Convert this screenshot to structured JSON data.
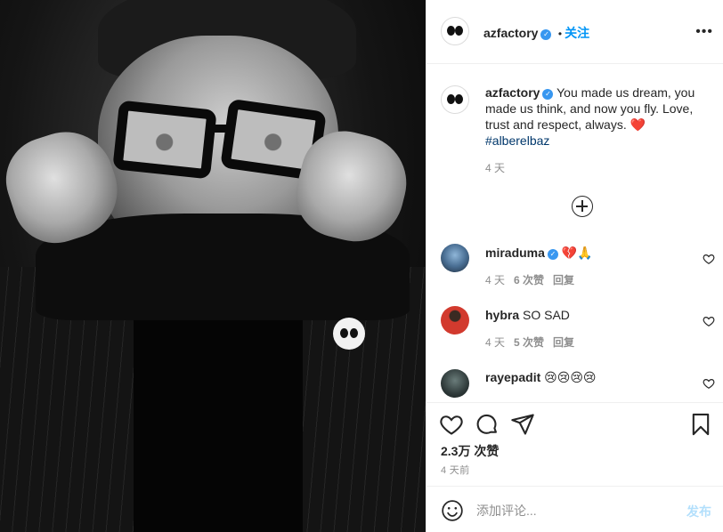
{
  "post": {
    "account": "azfactory",
    "follow_label": "关注",
    "separator": "•",
    "more_glyph": "•••"
  },
  "caption": {
    "username": "azfactory",
    "text": "You made us dream, you made us think, and now you fly. Love, trust and respect, always. ❤️",
    "hashtag": "#alberelbaz",
    "time": "4 天"
  },
  "comments": [
    {
      "username": "miraduma",
      "verified": true,
      "text": "💔🙏",
      "time": "4 天",
      "likes": "6 次赞",
      "reply": "回复"
    },
    {
      "username": "hybra",
      "verified": false,
      "text": "SO SAD",
      "time": "4 天",
      "likes": "5 次赞",
      "reply": "回复"
    },
    {
      "username": "rayepadit",
      "verified": false,
      "text": "😢😢😢😢",
      "time": "",
      "likes": "",
      "reply": ""
    }
  ],
  "stats": {
    "likes": "2.3万 次赞",
    "date": "4 天前"
  },
  "composer": {
    "placeholder": "添加评论...",
    "post_label": "发布"
  },
  "colors": {
    "link_blue": "#0095f6",
    "verified_blue": "#3897f0",
    "muted": "#8e8e8e",
    "post_disabled": "#b2dffc"
  }
}
